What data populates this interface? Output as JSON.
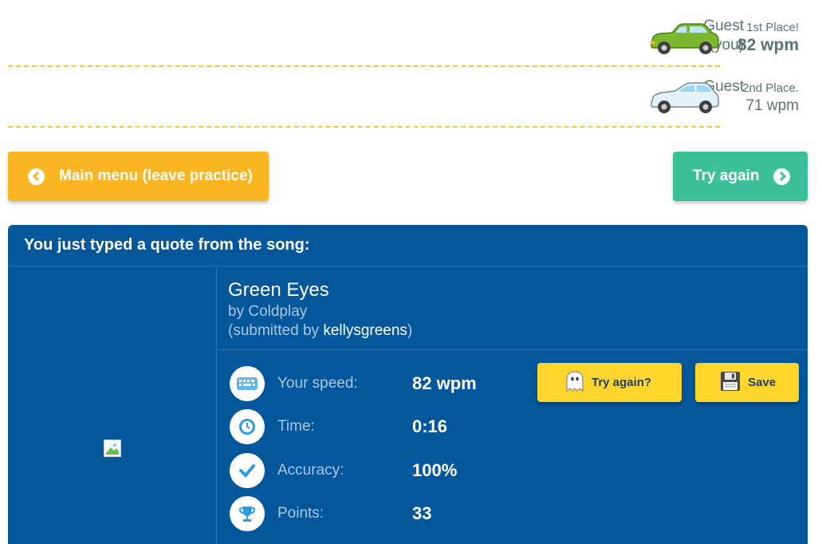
{
  "race": {
    "racers": [
      {
        "name_line1": "Guest",
        "name_line2": "(you)",
        "place": "1st Place!",
        "wpm": "82 wpm",
        "car_color": "#7cb82f"
      },
      {
        "name_line1": "Guest",
        "name_line2": "",
        "place": "2nd Place.",
        "wpm": "71 wpm",
        "car_color": "#e4f2f7"
      }
    ],
    "lane_color": "#f2cb3c"
  },
  "buttons": {
    "main_menu": "Main menu (leave practice)",
    "try_again": "Try again"
  },
  "quote": {
    "header": "You just typed a quote from the song:",
    "title": "Green Eyes",
    "by": "by Coldplay",
    "submitted_prefix": "(submitted by ",
    "submitter": "kellysgreens",
    "submitted_suffix": ")"
  },
  "stats": [
    {
      "label": "Your speed:",
      "value": "82 wpm",
      "icon": "keyboard-icon"
    },
    {
      "label": "Time:",
      "value": "0:16",
      "icon": "clock-icon"
    },
    {
      "label": "Accuracy:",
      "value": "100%",
      "icon": "checkmark-icon"
    },
    {
      "label": "Points:",
      "value": "33",
      "icon": "trophy-icon"
    }
  ],
  "actions": {
    "try_again": "Try again?",
    "save": "Save"
  },
  "colors": {
    "main_menu_bg": "#f9b522",
    "try_again_bg": "#3dbf9a",
    "panel_bg": "#05579b",
    "action_bg": "#fdd52c"
  }
}
